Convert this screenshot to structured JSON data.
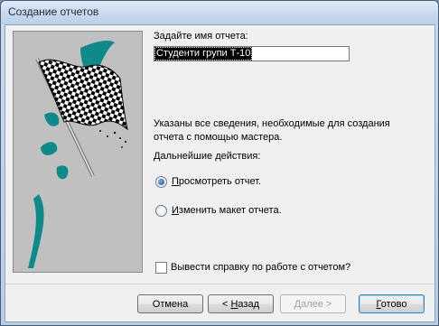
{
  "window": {
    "title": "Создание отчетов"
  },
  "name_prompt": "Задайте имя отчета:",
  "report_name": "Студенти групи Т-10",
  "info_line1": "Указаны все сведения, необходимые для создания",
  "info_line2": "отчета с помощью мастера.",
  "next_actions_label": "Дальнейшие действия:",
  "option_preview": {
    "mnemonic": "П",
    "rest": "росмотреть отчет.",
    "selected": true
  },
  "option_modify": {
    "mnemonic": "И",
    "rest": "зменить макет отчета.",
    "selected": false
  },
  "help_checkbox": {
    "label": "Вывести справку по работе с отчетом?",
    "checked": false
  },
  "buttons": {
    "cancel": "Отмена",
    "back_prefix": "< ",
    "back_mnemonic": "Н",
    "back_rest": "азад",
    "next_mnemonic": "Д",
    "next_rest": "алее >",
    "finish_mnemonic": "Г",
    "finish_rest": "отово"
  },
  "colors": {
    "accent_teal": "#0e8a8a",
    "picture_bg": "#c0c0c0",
    "default_button_border": "#3c7fb1"
  }
}
